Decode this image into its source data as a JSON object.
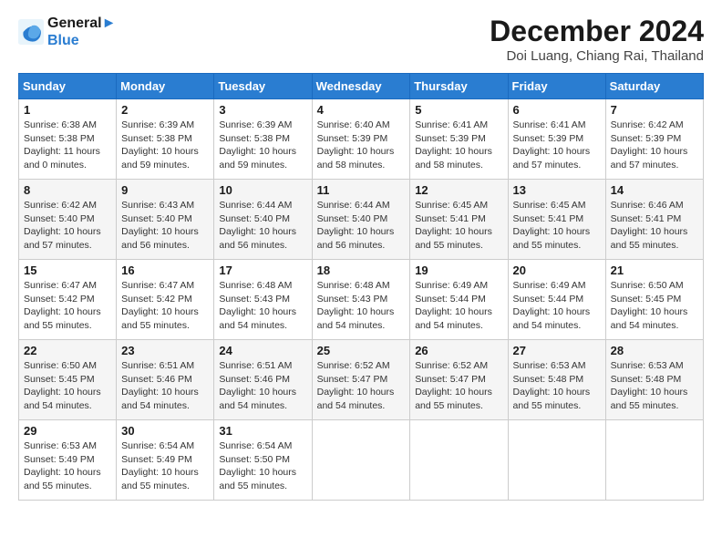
{
  "logo": {
    "line1": "General",
    "line2": "Blue"
  },
  "title": "December 2024",
  "location": "Doi Luang, Chiang Rai, Thailand",
  "weekdays": [
    "Sunday",
    "Monday",
    "Tuesday",
    "Wednesday",
    "Thursday",
    "Friday",
    "Saturday"
  ],
  "weeks": [
    [
      {
        "day": "1",
        "sunrise": "6:38 AM",
        "sunset": "5:38 PM",
        "daylight": "11 hours and 0 minutes."
      },
      {
        "day": "2",
        "sunrise": "6:39 AM",
        "sunset": "5:38 PM",
        "daylight": "10 hours and 59 minutes."
      },
      {
        "day": "3",
        "sunrise": "6:39 AM",
        "sunset": "5:38 PM",
        "daylight": "10 hours and 59 minutes."
      },
      {
        "day": "4",
        "sunrise": "6:40 AM",
        "sunset": "5:39 PM",
        "daylight": "10 hours and 58 minutes."
      },
      {
        "day": "5",
        "sunrise": "6:41 AM",
        "sunset": "5:39 PM",
        "daylight": "10 hours and 58 minutes."
      },
      {
        "day": "6",
        "sunrise": "6:41 AM",
        "sunset": "5:39 PM",
        "daylight": "10 hours and 57 minutes."
      },
      {
        "day": "7",
        "sunrise": "6:42 AM",
        "sunset": "5:39 PM",
        "daylight": "10 hours and 57 minutes."
      }
    ],
    [
      {
        "day": "8",
        "sunrise": "6:42 AM",
        "sunset": "5:40 PM",
        "daylight": "10 hours and 57 minutes."
      },
      {
        "day": "9",
        "sunrise": "6:43 AM",
        "sunset": "5:40 PM",
        "daylight": "10 hours and 56 minutes."
      },
      {
        "day": "10",
        "sunrise": "6:44 AM",
        "sunset": "5:40 PM",
        "daylight": "10 hours and 56 minutes."
      },
      {
        "day": "11",
        "sunrise": "6:44 AM",
        "sunset": "5:40 PM",
        "daylight": "10 hours and 56 minutes."
      },
      {
        "day": "12",
        "sunrise": "6:45 AM",
        "sunset": "5:41 PM",
        "daylight": "10 hours and 55 minutes."
      },
      {
        "day": "13",
        "sunrise": "6:45 AM",
        "sunset": "5:41 PM",
        "daylight": "10 hours and 55 minutes."
      },
      {
        "day": "14",
        "sunrise": "6:46 AM",
        "sunset": "5:41 PM",
        "daylight": "10 hours and 55 minutes."
      }
    ],
    [
      {
        "day": "15",
        "sunrise": "6:47 AM",
        "sunset": "5:42 PM",
        "daylight": "10 hours and 55 minutes."
      },
      {
        "day": "16",
        "sunrise": "6:47 AM",
        "sunset": "5:42 PM",
        "daylight": "10 hours and 55 minutes."
      },
      {
        "day": "17",
        "sunrise": "6:48 AM",
        "sunset": "5:43 PM",
        "daylight": "10 hours and 54 minutes."
      },
      {
        "day": "18",
        "sunrise": "6:48 AM",
        "sunset": "5:43 PM",
        "daylight": "10 hours and 54 minutes."
      },
      {
        "day": "19",
        "sunrise": "6:49 AM",
        "sunset": "5:44 PM",
        "daylight": "10 hours and 54 minutes."
      },
      {
        "day": "20",
        "sunrise": "6:49 AM",
        "sunset": "5:44 PM",
        "daylight": "10 hours and 54 minutes."
      },
      {
        "day": "21",
        "sunrise": "6:50 AM",
        "sunset": "5:45 PM",
        "daylight": "10 hours and 54 minutes."
      }
    ],
    [
      {
        "day": "22",
        "sunrise": "6:50 AM",
        "sunset": "5:45 PM",
        "daylight": "10 hours and 54 minutes."
      },
      {
        "day": "23",
        "sunrise": "6:51 AM",
        "sunset": "5:46 PM",
        "daylight": "10 hours and 54 minutes."
      },
      {
        "day": "24",
        "sunrise": "6:51 AM",
        "sunset": "5:46 PM",
        "daylight": "10 hours and 54 minutes."
      },
      {
        "day": "25",
        "sunrise": "6:52 AM",
        "sunset": "5:47 PM",
        "daylight": "10 hours and 54 minutes."
      },
      {
        "day": "26",
        "sunrise": "6:52 AM",
        "sunset": "5:47 PM",
        "daylight": "10 hours and 55 minutes."
      },
      {
        "day": "27",
        "sunrise": "6:53 AM",
        "sunset": "5:48 PM",
        "daylight": "10 hours and 55 minutes."
      },
      {
        "day": "28",
        "sunrise": "6:53 AM",
        "sunset": "5:48 PM",
        "daylight": "10 hours and 55 minutes."
      }
    ],
    [
      {
        "day": "29",
        "sunrise": "6:53 AM",
        "sunset": "5:49 PM",
        "daylight": "10 hours and 55 minutes."
      },
      {
        "day": "30",
        "sunrise": "6:54 AM",
        "sunset": "5:49 PM",
        "daylight": "10 hours and 55 minutes."
      },
      {
        "day": "31",
        "sunrise": "6:54 AM",
        "sunset": "5:50 PM",
        "daylight": "10 hours and 55 minutes."
      },
      null,
      null,
      null,
      null
    ]
  ]
}
